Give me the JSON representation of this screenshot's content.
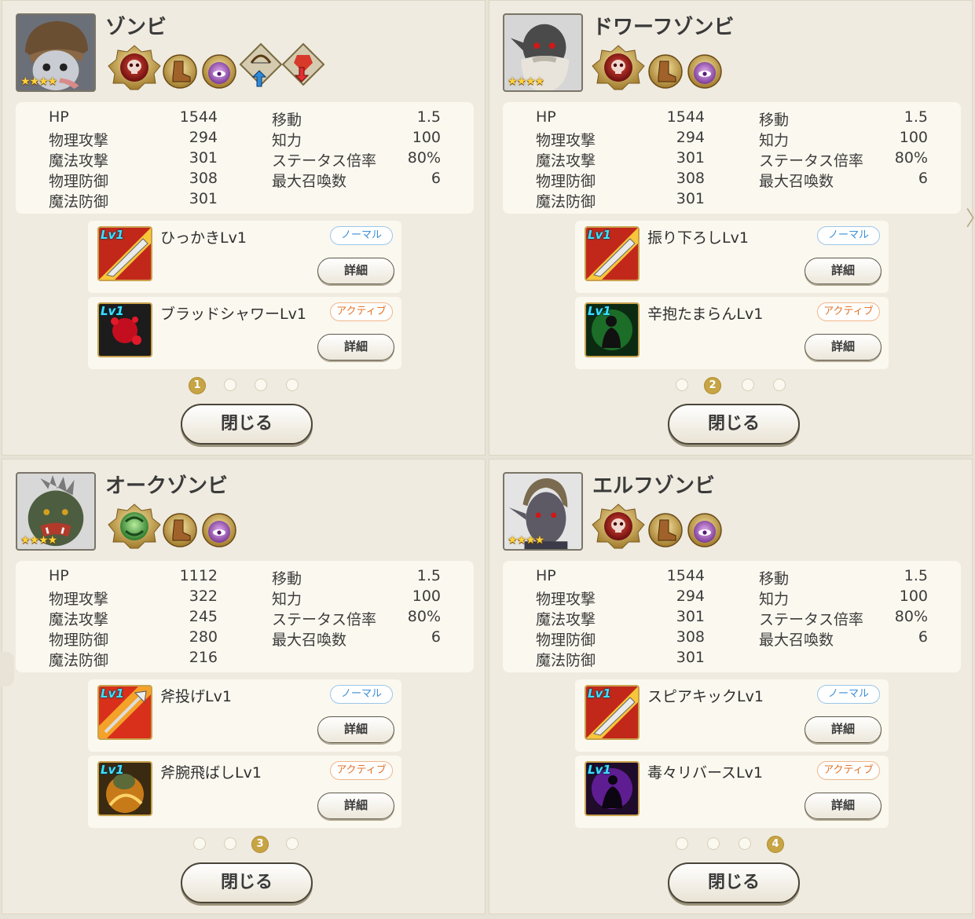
{
  "close_label": "閉じる",
  "detail_label": "詳細",
  "stars": "★★★★",
  "tags": {
    "normal": "ノーマル",
    "active": "アクティブ"
  },
  "labels": {
    "hp": "HP",
    "patk": "物理攻撃",
    "matk": "魔法攻撃",
    "pdef": "物理防御",
    "mdef": "魔法防御",
    "move": "移動",
    "int": "知力",
    "rate": "ステータス倍率",
    "summon": "最大召喚数"
  },
  "lv_badge": "Lv1",
  "panels": [
    {
      "name": "ゾンビ",
      "stats": {
        "hp": "1544",
        "patk": "294",
        "matk": "301",
        "pdef": "308",
        "mdef": "301",
        "move": "1.5",
        "int": "100",
        "rate": "80%",
        "summon": "6"
      },
      "skills": [
        {
          "name": "ひっかきLv1",
          "tag": "ノーマル"
        },
        {
          "name": "ブラッドシャワーLv1",
          "tag": "アクティブ"
        }
      ],
      "page": "1"
    },
    {
      "name": "ドワーフゾンビ",
      "stats": {
        "hp": "1544",
        "patk": "294",
        "matk": "301",
        "pdef": "308",
        "mdef": "301",
        "move": "1.5",
        "int": "100",
        "rate": "80%",
        "summon": "6"
      },
      "skills": [
        {
          "name": "振り下ろしLv1",
          "tag": "ノーマル"
        },
        {
          "name": "辛抱たまらんLv1",
          "tag": "アクティブ"
        }
      ],
      "page": "2"
    },
    {
      "name": "オークゾンビ",
      "stats": {
        "hp": "1112",
        "patk": "322",
        "matk": "245",
        "pdef": "280",
        "mdef": "216",
        "move": "1.5",
        "int": "100",
        "rate": "80%",
        "summon": "6"
      },
      "skills": [
        {
          "name": "斧投げLv1",
          "tag": "ノーマル"
        },
        {
          "name": "斧腕飛ばしLv1",
          "tag": "アクティブ"
        }
      ],
      "page": "3"
    },
    {
      "name": "エルフゾンビ",
      "stats": {
        "hp": "1544",
        "patk": "294",
        "matk": "301",
        "pdef": "308",
        "mdef": "301",
        "move": "1.5",
        "int": "100",
        "rate": "80%",
        "summon": "6"
      },
      "skills": [
        {
          "name": "スピアキックLv1",
          "tag": "ノーマル"
        },
        {
          "name": "毒々リバースLv1",
          "tag": "アクティブ"
        }
      ],
      "page": "4"
    }
  ]
}
